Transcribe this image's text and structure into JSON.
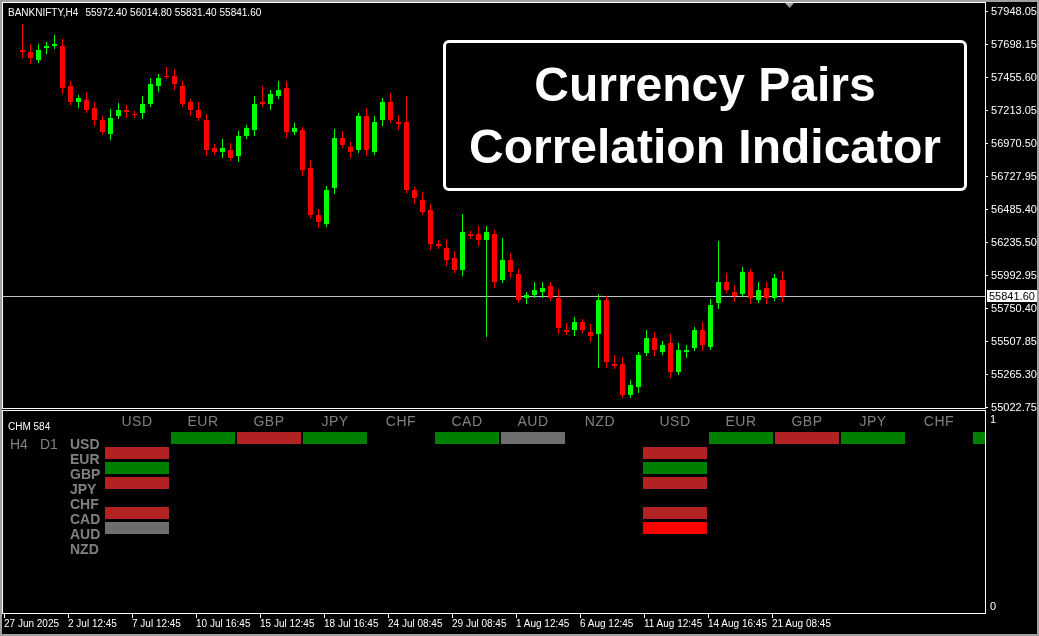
{
  "chart": {
    "symbol": "BANKNIFTY,H4",
    "ohlc": [
      "55972.40",
      "56014.80",
      "55831.40",
      "55841.60"
    ],
    "title_lines": [
      "Currency Pairs",
      "Correlation Indicator"
    ],
    "price_ticks": [
      "57948.05",
      "57698.15",
      "57455.60",
      "57213.05",
      "56970.50",
      "56727.95",
      "56485.40",
      "56235.50",
      "55992.95",
      "55750.40",
      "55507.85",
      "55265.30",
      "55022.75"
    ],
    "current_price": "55841.60"
  },
  "indicator": {
    "name": "CHM 584",
    "timeframes": [
      "H4",
      "D1"
    ],
    "row_labels": [
      "USD",
      "EUR",
      "GBP",
      "JPY",
      "CHF",
      "CAD",
      "AUD",
      "NZD"
    ],
    "blocks": [
      {
        "columns": [
          {
            "label": "USD",
            "cells": [
              {
                "kind": "blank"
              },
              {
                "kind": "bar",
                "color": "#b22222"
              },
              {
                "kind": "bar",
                "color": "#008000"
              },
              {
                "kind": "bar",
                "color": "#b22222"
              },
              {
                "kind": "blank"
              },
              {
                "kind": "bar",
                "color": "#b22222"
              },
              {
                "kind": "bar",
                "color": "#6e6e6e"
              },
              {
                "kind": "blank"
              }
            ]
          },
          {
            "label": "EUR",
            "cells": [
              {
                "kind": "bar",
                "color": "#008000"
              },
              {
                "kind": "blank"
              },
              {
                "kind": "blank"
              },
              {
                "kind": "blank"
              },
              {
                "kind": "blank"
              },
              {
                "kind": "blank"
              },
              {
                "kind": "blank"
              },
              {
                "kind": "blank"
              }
            ]
          },
          {
            "label": "GBP",
            "cells": [
              {
                "kind": "bar",
                "color": "#b22222"
              },
              {
                "kind": "blank"
              },
              {
                "kind": "blank"
              },
              {
                "kind": "blank"
              },
              {
                "kind": "blank"
              },
              {
                "kind": "blank"
              },
              {
                "kind": "blank"
              },
              {
                "kind": "blank"
              }
            ]
          },
          {
            "label": "JPY",
            "cells": [
              {
                "kind": "bar",
                "color": "#008000"
              },
              {
                "kind": "blank"
              },
              {
                "kind": "blank"
              },
              {
                "kind": "blank"
              },
              {
                "kind": "blank"
              },
              {
                "kind": "blank"
              },
              {
                "kind": "blank"
              },
              {
                "kind": "blank"
              }
            ]
          },
          {
            "label": "CHF",
            "cells": [
              {
                "kind": "blank"
              },
              {
                "kind": "blank"
              },
              {
                "kind": "blank"
              },
              {
                "kind": "blank"
              },
              {
                "kind": "blank"
              },
              {
                "kind": "blank"
              },
              {
                "kind": "blank"
              },
              {
                "kind": "blank"
              }
            ]
          },
          {
            "label": "CAD",
            "cells": [
              {
                "kind": "bar",
                "color": "#008000"
              },
              {
                "kind": "blank"
              },
              {
                "kind": "blank"
              },
              {
                "kind": "blank"
              },
              {
                "kind": "blank"
              },
              {
                "kind": "blank"
              },
              {
                "kind": "blank"
              },
              {
                "kind": "blank"
              }
            ]
          },
          {
            "label": "AUD",
            "cells": [
              {
                "kind": "bar",
                "color": "#6e6e6e"
              },
              {
                "kind": "blank"
              },
              {
                "kind": "blank"
              },
              {
                "kind": "blank"
              },
              {
                "kind": "blank"
              },
              {
                "kind": "blank"
              },
              {
                "kind": "blank"
              },
              {
                "kind": "blank"
              }
            ]
          },
          {
            "label": "NZD",
            "cells": [
              {
                "kind": "blank"
              },
              {
                "kind": "blank"
              },
              {
                "kind": "blank"
              },
              {
                "kind": "blank"
              },
              {
                "kind": "blank"
              },
              {
                "kind": "blank"
              },
              {
                "kind": "blank"
              },
              {
                "kind": "blank"
              }
            ]
          }
        ]
      },
      {
        "columns": [
          {
            "label": "USD",
            "cells": [
              {
                "kind": "blank"
              },
              {
                "kind": "bar",
                "color": "#b22222"
              },
              {
                "kind": "bar",
                "color": "#008000"
              },
              {
                "kind": "bar",
                "color": "#b22222"
              },
              {
                "kind": "blank"
              },
              {
                "kind": "bar",
                "color": "#b22222"
              },
              {
                "kind": "bar",
                "color": "#ff0000"
              },
              {
                "kind": "blank"
              }
            ]
          },
          {
            "label": "EUR",
            "cells": [
              {
                "kind": "bar",
                "color": "#008000"
              },
              {
                "kind": "blank"
              },
              {
                "kind": "blank"
              },
              {
                "kind": "blank"
              },
              {
                "kind": "blank"
              },
              {
                "kind": "blank"
              },
              {
                "kind": "blank"
              },
              {
                "kind": "blank"
              }
            ]
          },
          {
            "label": "GBP",
            "cells": [
              {
                "kind": "bar",
                "color": "#b22222"
              },
              {
                "kind": "blank"
              },
              {
                "kind": "blank"
              },
              {
                "kind": "blank"
              },
              {
                "kind": "blank"
              },
              {
                "kind": "blank"
              },
              {
                "kind": "blank"
              },
              {
                "kind": "blank"
              }
            ]
          },
          {
            "label": "JPY",
            "cells": [
              {
                "kind": "bar",
                "color": "#008000"
              },
              {
                "kind": "blank"
              },
              {
                "kind": "blank"
              },
              {
                "kind": "blank"
              },
              {
                "kind": "blank"
              },
              {
                "kind": "blank"
              },
              {
                "kind": "blank"
              },
              {
                "kind": "blank"
              }
            ]
          },
          {
            "label": "CHF",
            "cells": [
              {
                "kind": "blank"
              },
              {
                "kind": "blank"
              },
              {
                "kind": "blank"
              },
              {
                "kind": "blank"
              },
              {
                "kind": "blank"
              },
              {
                "kind": "blank"
              },
              {
                "kind": "blank"
              },
              {
                "kind": "blank"
              }
            ]
          },
          {
            "cells": [
              {
                "kind": "bar",
                "color": "#008000"
              },
              {
                "kind": "blank"
              },
              {
                "kind": "blank"
              },
              {
                "kind": "blank"
              },
              {
                "kind": "blank"
              },
              {
                "kind": "blank"
              },
              {
                "kind": "blank"
              },
              {
                "kind": "blank"
              }
            ]
          }
        ]
      }
    ],
    "scale": [
      "1",
      "0"
    ]
  },
  "time_axis": [
    "27 Jun 2025",
    "2 Jul 12:45",
    "7 Jul 12:45",
    "10 Jul 16:45",
    "15 Jul 12:45",
    "18 Jul 16:45",
    "24 Jul 08:45",
    "29 Jul 08:45",
    "1 Aug 12:45",
    "6 Aug 12:45",
    "11 Aug 12:45",
    "14 Aug 16:45",
    "21 Aug 08:45"
  ]
}
